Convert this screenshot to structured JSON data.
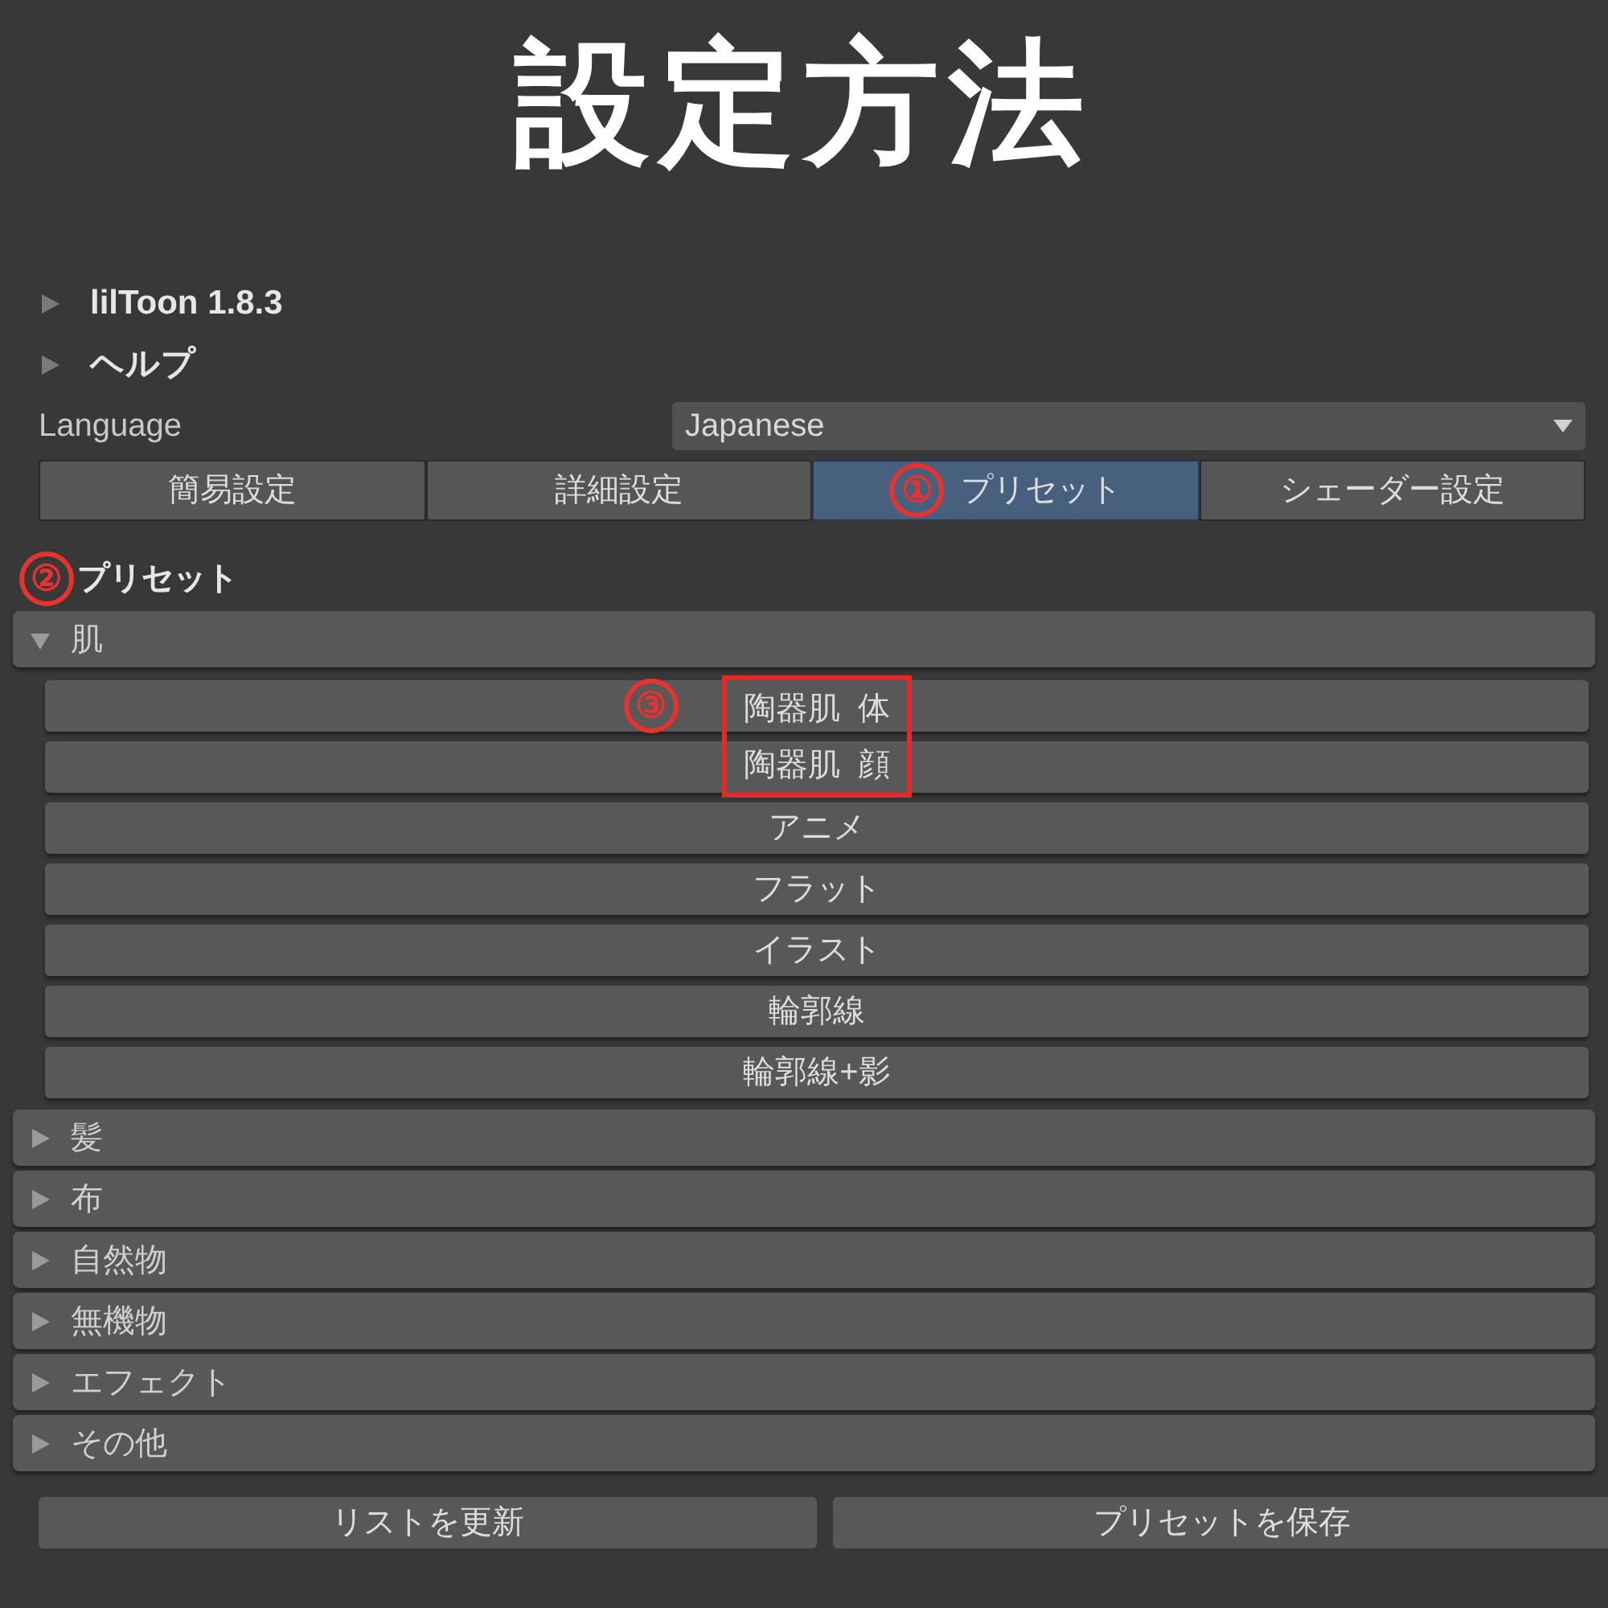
{
  "heading": "設定方法",
  "foldouts": [
    {
      "label": "lilToon 1.8.3",
      "expanded": false
    },
    {
      "label": "ヘルプ",
      "expanded": false
    }
  ],
  "language": {
    "label": "Language",
    "value": "Japanese"
  },
  "tabs": [
    {
      "label": "簡易設定",
      "selected": false
    },
    {
      "label": "詳細設定",
      "selected": false
    },
    {
      "label": "プリセット",
      "selected": true,
      "marker": "①"
    },
    {
      "label": "シェーダー設定",
      "selected": false
    }
  ],
  "section": {
    "title": "プリセット",
    "marker": "②"
  },
  "categories": [
    {
      "label": "肌",
      "expanded": true,
      "marker": "③",
      "children": [
        {
          "label": "陶器肌  体",
          "highlighted": true
        },
        {
          "label": "陶器肌  顔",
          "highlighted": true
        },
        {
          "label": "アニメ",
          "highlighted": false
        },
        {
          "label": "フラット",
          "highlighted": false
        },
        {
          "label": "イラスト",
          "highlighted": false
        },
        {
          "label": "輪郭線",
          "highlighted": false
        },
        {
          "label": "輪郭線+影",
          "highlighted": false
        }
      ]
    },
    {
      "label": "髪",
      "expanded": false
    },
    {
      "label": "布",
      "expanded": false
    },
    {
      "label": "自然物",
      "expanded": false
    },
    {
      "label": "無機物",
      "expanded": false
    },
    {
      "label": "エフェクト",
      "expanded": false
    },
    {
      "label": "その他",
      "expanded": false
    }
  ],
  "buttons": [
    "リストを更新",
    "プリセットを保存"
  ]
}
